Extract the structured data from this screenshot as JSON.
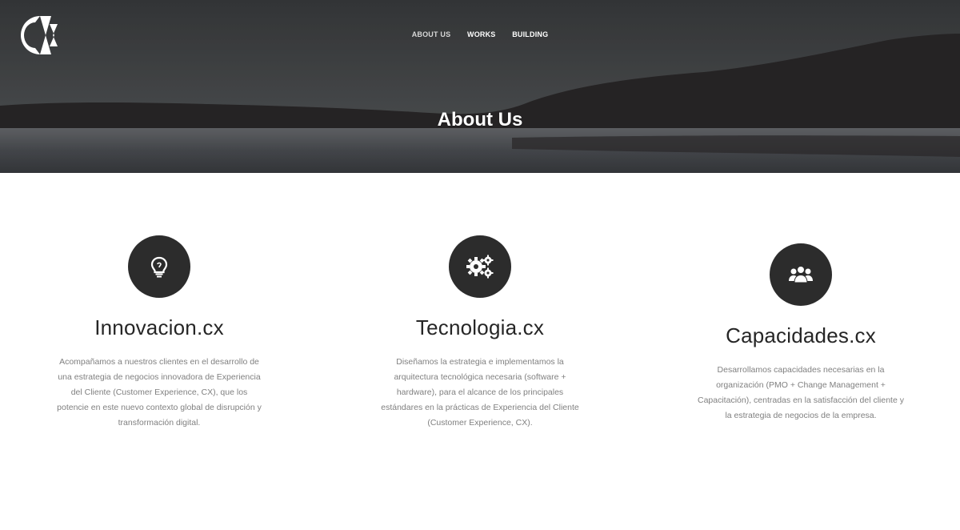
{
  "header": {
    "logo_icon": "cx-logo-icon",
    "nav": [
      {
        "label": "ABOUT US",
        "active": true
      },
      {
        "label": "WORKS",
        "active": false
      },
      {
        "label": "BUILDING",
        "active": false
      }
    ],
    "title": "About Us"
  },
  "features": [
    {
      "icon": "lightbulb-icon",
      "title": "Innovacion.cx",
      "description": "Acompañamos a nuestros clientes en el desarrollo de una estrategia de negocios innovadora de Experiencia del Cliente (Customer Experience, CX), que los potencie en este nuevo contexto global de disrupción y transformación digital."
    },
    {
      "icon": "gears-icon",
      "title": "Tecnologia.cx",
      "description": "Diseñamos la estrategia e implementamos la arquitectura tecnológica necesaria (software + hardware), para el alcance de los principales estándares en la prácticas de Experiencia del Cliente (Customer Experience, CX)."
    },
    {
      "icon": "users-icon",
      "title": "Capacidades.cx",
      "description": "Desarrollamos capacidades necesarias en la organización (PMO + Change Management + Capacitación), centradas en la satisfacción del cliente y la estrategia de negocios de la empresa."
    }
  ],
  "colors": {
    "icon_circle": "#2c2c2c",
    "heading": "#262626",
    "body_text": "#808080",
    "nav_text": "#ffffff"
  }
}
